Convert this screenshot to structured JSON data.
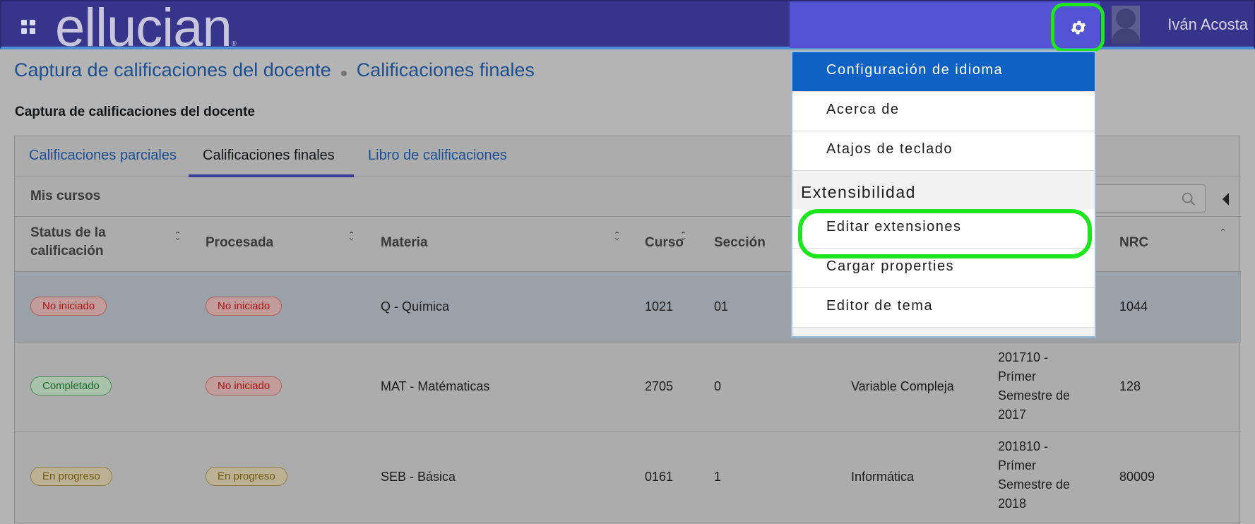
{
  "header": {
    "logo_text": "ellucian",
    "logo_mark": "®",
    "user_name": "Iván Acosta",
    "accent_color": "#37348b",
    "icons": [
      "grid-icon",
      "gear-icon",
      "avatar-icon"
    ]
  },
  "breadcrumb": {
    "items": [
      "Captura de calificaciones del docente",
      "Calificaciones finales"
    ]
  },
  "page_title": "Captura de calificaciones del docente",
  "tabs": [
    {
      "label": "Calificaciones parciales",
      "active": false
    },
    {
      "label": "Calificaciones finales",
      "active": true
    },
    {
      "label": "Libro de calificaciones",
      "active": false
    }
  ],
  "section": {
    "title": "Mis cursos"
  },
  "table": {
    "headers": {
      "status": "Status de la calificación",
      "procesada": "Procesada",
      "materia": "Materia",
      "curso": "Curso",
      "seccion": "Sección",
      "nrc": "NRC"
    },
    "rows": [
      {
        "status": "No iniciado",
        "procesada": "No iniciado",
        "materia": "Q - Química",
        "curso": "1021",
        "seccion": "01",
        "titulo": "",
        "periodo": "",
        "nrc": "1044"
      },
      {
        "status": "Completado",
        "procesada": "No iniciado",
        "materia": "MAT - Matématicas",
        "curso": "2705",
        "seccion": "0",
        "titulo": "Variable Compleja",
        "periodo": "201710 - Prímer Semestre de 2017",
        "nrc": "128"
      },
      {
        "status": "En progreso",
        "procesada": "En progreso",
        "materia": "SEB - Básica",
        "curso": "0161",
        "seccion": "1",
        "titulo": "Informática",
        "periodo": "201810 - Prímer Semestre de 2018",
        "nrc": "80009"
      }
    ]
  },
  "settings_menu": {
    "items": [
      {
        "label": "Configuración de idioma",
        "selected": true
      },
      {
        "label": "Acerca de",
        "selected": false
      },
      {
        "label": "Atajos de teclado",
        "selected": false
      }
    ],
    "group_label": "Extensibilidad",
    "group_items": [
      {
        "label": "Editar extensiones",
        "highlighted": true
      },
      {
        "label": "Cargar properties"
      },
      {
        "label": "Editor de tema"
      }
    ]
  }
}
